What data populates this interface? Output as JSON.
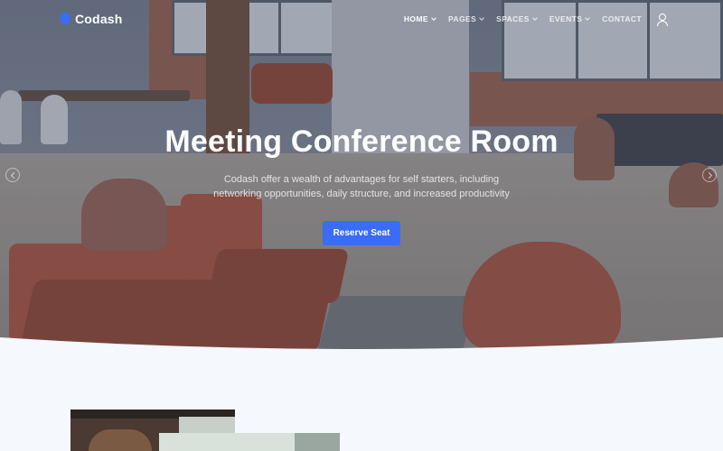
{
  "nav": {
    "brand": "Codash",
    "items": [
      {
        "label": "HOME",
        "has_dropdown": true,
        "active": true
      },
      {
        "label": "PAGES",
        "has_dropdown": true,
        "active": false
      },
      {
        "label": "SPACES",
        "has_dropdown": true,
        "active": false
      },
      {
        "label": "EVENTS",
        "has_dropdown": true,
        "active": false
      },
      {
        "label": "CONTACT",
        "has_dropdown": false,
        "active": false
      }
    ],
    "user_icon": "user-icon"
  },
  "hero": {
    "title": "Meeting Conference Room",
    "subtitle_line1": "Codash offer a wealth of advantages for self starters, including",
    "subtitle_line2": "networking opportunities, daily structure, and increased productivity",
    "button_label": "Reserve Seat"
  },
  "colors": {
    "accent": "#3b6cf6",
    "page_background": "#f5f8fd"
  }
}
